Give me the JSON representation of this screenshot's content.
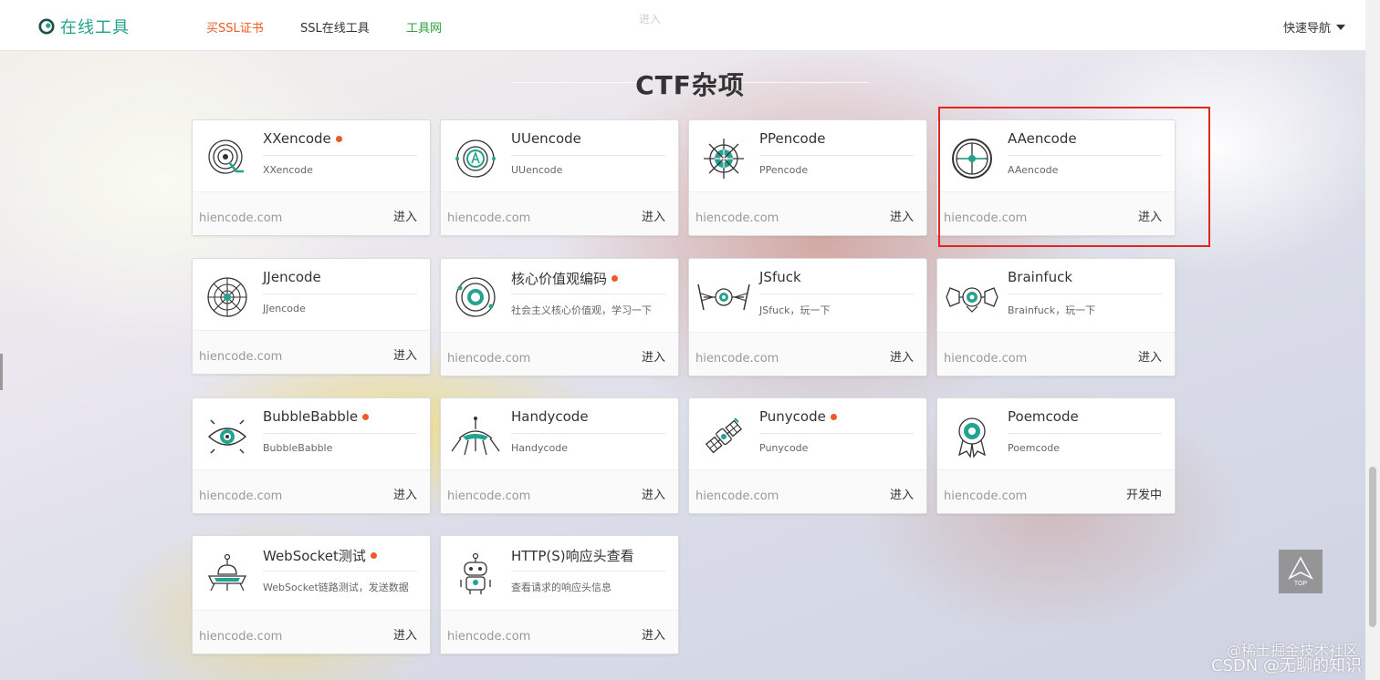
{
  "nav": {
    "logo_text": "在线工具",
    "links": [
      {
        "label": "买SSL证书",
        "color": "#f05a24"
      },
      {
        "label": "SSL在线工具",
        "color": "#333333"
      },
      {
        "label": "工具网",
        "color": "#2e9e3e"
      }
    ],
    "ghost_left": "",
    "ghost_right": "进入",
    "quick_nav": "快速导航"
  },
  "section_title": "CTF杂项",
  "colors": {
    "accent": "#23a28e",
    "new_dot": "#f05a24",
    "highlight": "#e0261e"
  },
  "cards": [
    {
      "name": "XXencode",
      "desc": "XXencode",
      "domain": "hiencode.com",
      "action": "进入",
      "is_new": true,
      "icon": "target-icon"
    },
    {
      "name": "UUencode",
      "desc": "UUencode",
      "domain": "hiencode.com",
      "action": "进入",
      "is_new": false,
      "icon": "compass-icon"
    },
    {
      "name": "PPencode",
      "desc": "PPencode",
      "domain": "hiencode.com",
      "action": "进入",
      "is_new": false,
      "icon": "helm-icon"
    },
    {
      "name": "AAencode",
      "desc": "AAencode",
      "domain": "hiencode.com",
      "action": "进入",
      "is_new": false,
      "icon": "wheel-icon"
    },
    {
      "name": "JJencode",
      "desc": "JJencode",
      "domain": "hiencode.com",
      "action": "进入",
      "is_new": false,
      "icon": "web-icon"
    },
    {
      "name": "核心价值观编码",
      "desc": "社会主义核心价值观，学习一下",
      "domain": "hiencode.com",
      "action": "进入",
      "is_new": true,
      "icon": "orbit-icon"
    },
    {
      "name": "JSfuck",
      "desc": "JSfuck，玩一下",
      "domain": "hiencode.com",
      "action": "进入",
      "is_new": false,
      "icon": "tie-fighter-icon"
    },
    {
      "name": "Brainfuck",
      "desc": "Brainfuck，玩一下",
      "domain": "hiencode.com",
      "action": "进入",
      "is_new": false,
      "icon": "bot-ship-icon"
    },
    {
      "name": "BubbleBabble",
      "desc": "BubbleBabble",
      "domain": "hiencode.com",
      "action": "进入",
      "is_new": true,
      "icon": "eye-icon"
    },
    {
      "name": "Handycode",
      "desc": "Handycode",
      "domain": "hiencode.com",
      "action": "进入",
      "is_new": false,
      "icon": "lander-icon"
    },
    {
      "name": "Punycode",
      "desc": "Punycode",
      "domain": "hiencode.com",
      "action": "进入",
      "is_new": true,
      "icon": "satellite-icon"
    },
    {
      "name": "Poemcode",
      "desc": "Poemcode",
      "domain": "hiencode.com",
      "action": "开发中",
      "is_new": false,
      "icon": "badge-icon"
    },
    {
      "name": "WebSocket测试",
      "desc": "WebSocket链路测试，发送数据",
      "domain": "hiencode.com",
      "action": "进入",
      "is_new": true,
      "icon": "ufo-icon"
    },
    {
      "name": "HTTP(S)响应头查看",
      "desc": "查看请求的响应头信息",
      "domain": "hiencode.com",
      "action": "进入",
      "is_new": false,
      "icon": "robot-icon"
    }
  ],
  "top_button": "TOP",
  "watermark_top": "@稀土掘金技术社区",
  "watermark": "CSDN @无聊的知识"
}
